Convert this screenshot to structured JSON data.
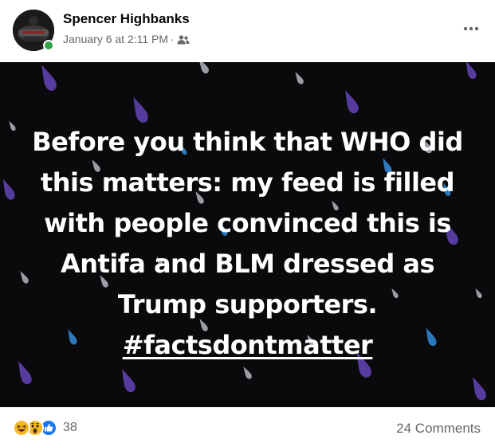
{
  "post": {
    "author": "Spencer Highbanks",
    "timestamp": "January 6 at 2:11 PM",
    "meta_separator": "·",
    "audience_icon": "friends-icon",
    "more_icon": "more-horizontal-icon",
    "text_lines": [
      "Before you think that WHO did",
      "this matters: my feed is filled",
      "with people convinced this is",
      "Antifa and BLM dressed as",
      "Trump supporters."
    ],
    "hashtag": "#factsdontmatter",
    "background_color": "#0a0a0c",
    "drop_colors": [
      "#5b3fa6",
      "#2f7fc8",
      "#c9cfd8"
    ]
  },
  "footer": {
    "reaction_icons": [
      "haha-icon",
      "wow-icon",
      "like-icon"
    ],
    "reaction_count": "38",
    "comments": "24 Comments"
  },
  "colors": {
    "online": "#31a24c",
    "secondary_text": "#65676b",
    "like_blue": "#1877f2",
    "emoji_yellow": "#f7b928"
  }
}
